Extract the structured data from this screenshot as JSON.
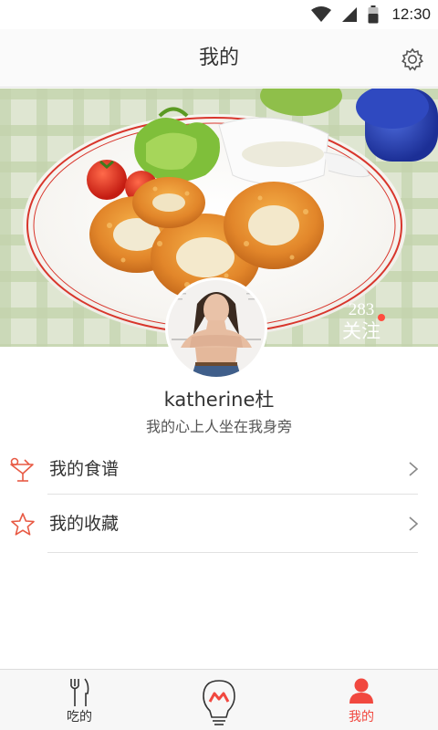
{
  "status_bar": {
    "time": "12:30"
  },
  "header": {
    "title": "我的"
  },
  "profile": {
    "follow_count": "283",
    "follow_label": "关注",
    "username": "katherine杜",
    "signature": "我的心上人坐在我身旁"
  },
  "menu": [
    {
      "label": "我的食谱",
      "icon": "cocktail-glass-icon"
    },
    {
      "label": "我的收藏",
      "icon": "star-icon"
    }
  ],
  "bottom_nav": {
    "tabs": [
      {
        "label": "吃的",
        "icon": "fork-knife-icon",
        "active": false
      },
      {
        "label": "",
        "icon": "lightbulb-icon",
        "active": false
      },
      {
        "label": "我的",
        "icon": "person-icon",
        "active": true
      }
    ]
  },
  "colors": {
    "accent": "#f1483f",
    "text": "#333333"
  }
}
